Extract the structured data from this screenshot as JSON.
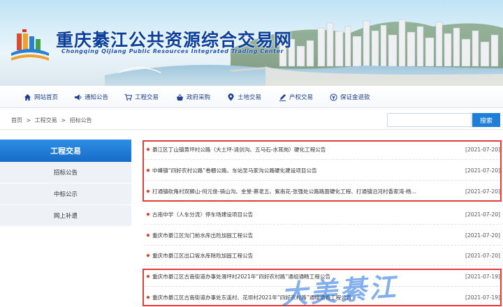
{
  "header": {
    "title": "重庆綦江公共资源综合交易网",
    "subtitle": "Chongqing Qijiang Public Resources Integrated Trading Center"
  },
  "nav": [
    {
      "label": "网站首页",
      "icon": "home-icon"
    },
    {
      "label": "通知公告",
      "icon": "megaphone-icon"
    },
    {
      "label": "工程交易",
      "icon": "cart-icon"
    },
    {
      "label": "政府采购",
      "icon": "basket-icon"
    },
    {
      "label": "土地交易",
      "icon": "location-pin-icon"
    },
    {
      "label": "产权交易",
      "icon": "pen-icon"
    },
    {
      "label": "保证金退款",
      "icon": "refund-icon"
    }
  ],
  "breadcrumb": [
    "首页",
    ">",
    "工程交易",
    ">",
    "招标公告"
  ],
  "search": {
    "placeholder": "",
    "button_label": "搜索"
  },
  "sidebar": {
    "heading": "工程交易",
    "items": [
      "招标公告",
      "中标公示",
      "网上补遗"
    ]
  },
  "list": [
    {
      "title": "綦江区丁山镇黄坪村公路（大土坪-清剑沟、五马石-水耳岗）硬化工程公告",
      "date": "[2021-07-20]"
    },
    {
      "title": "中峰镇“四好农村公路”卷棚公路、车站至马家沟公路硬化建设项目公告",
      "date": "[2021-07-20]"
    },
    {
      "title": "打通镇砍角村双狮山-何元俊-骑山沟、金堂-蔡老五、紫南花-张强处公路路面硬化工程、打通镇沿河村香家湾-杨...",
      "date": "[2021-07-20]"
    },
    {
      "title": "古南中学（人车分流）停车场建设项目公告",
      "date": "[2021-07-20]"
    },
    {
      "title": "重庆市綦江区沟门前水库出险加固工程公告",
      "date": "[2021-07-20]"
    },
    {
      "title": "重庆市綦江区出口坂水库除险加固工程公告",
      "date": "[2021-07-20]"
    },
    {
      "title": "重庆市綦江区古南街道办事处滑坪村2021年“四好农村路”通组通畅工程公告",
      "date": "[2021-07-19]"
    },
    {
      "title": "重庆市綦江区古南街道办事处东溪村、花坝村2021年“四好农村路”通组通畅工程公告",
      "date": "[2021-07-19]"
    }
  ],
  "watermark": "大美綦江",
  "colors": {
    "primary": "#1f7fd8",
    "nav_text": "#1d3f8f",
    "highlight_box": "#e23b3b",
    "bullet": "#d8422c"
  }
}
